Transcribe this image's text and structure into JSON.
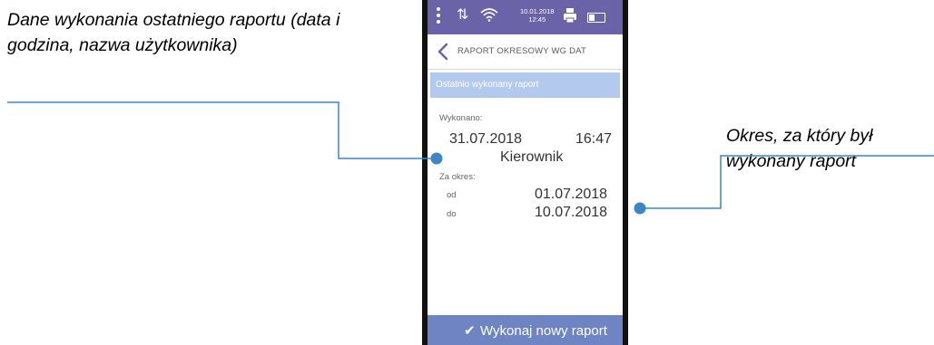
{
  "callouts": {
    "left": "Dane wykonania ostatniego raportu (data i godzina, nazwa użytkownika)",
    "right": "Okres, za który był wykonany raport"
  },
  "status_bar": {
    "date": "10.01.2018",
    "time": "12:45"
  },
  "header": {
    "title": "RAPORT OKRESOWY WG DAT"
  },
  "section": {
    "title": "Ostatnio wykonany raport"
  },
  "report": {
    "executed_label": "Wykonano:",
    "executed_date": "31.07.2018",
    "executed_time": "16:47",
    "user": "Kierownik",
    "period_label": "Za okres:",
    "from_label": "od",
    "from_date": "01.07.2018",
    "to_label": "do",
    "to_date": "10.07.2018"
  },
  "action": {
    "label": "Wykonaj nowy raport"
  },
  "colors": {
    "status_bar": "#6b63a8",
    "section_bar": "#b4c9ee",
    "button": "#6f84c2",
    "callout_line": "#3c86c8"
  }
}
